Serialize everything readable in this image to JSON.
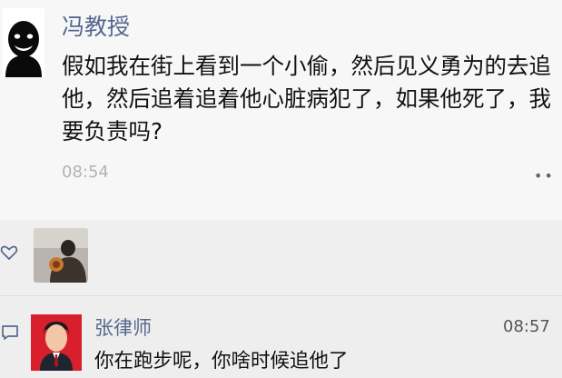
{
  "post": {
    "author": "冯教授",
    "avatar_icon": "person-silhouette-icon",
    "text": "假如我在街上看到一个小偷，然后见义勇为的去追他，然后追着追着他心脏病犯了，如果他死了，我要负责吗?",
    "time": "08:54",
    "more_label": "••"
  },
  "likes": {
    "icon": "heart-icon"
  },
  "comment": {
    "icon": "comment-icon",
    "author": "张律师",
    "time": "08:57",
    "text": "你在跑步呢，你啥时候追他了"
  },
  "colors": {
    "name_link": "#56688f",
    "background": "#f7f7f7",
    "comment_bg": "#eeeeee",
    "avatar2_bg": "#d8202c"
  }
}
